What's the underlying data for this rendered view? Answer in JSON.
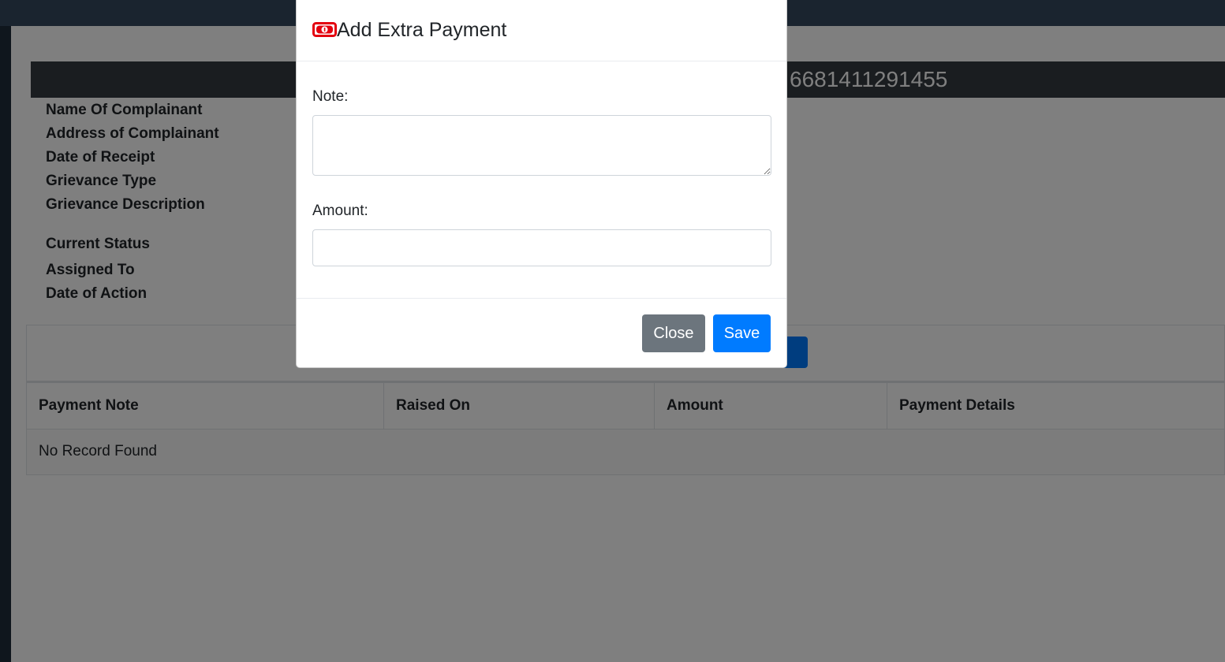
{
  "page": {
    "case_number": "6681411291455",
    "details": {
      "name_of_complainant": "Name Of Complainant",
      "address_of_complainant": "Address of Complainant",
      "date_of_receipt": "Date of Receipt",
      "grievance_type": "Grievance Type",
      "grievance_description": "Grievance Description",
      "current_status": "Current Status",
      "assigned_to": "Assigned To",
      "date_of_action": "Date of Action"
    },
    "table": {
      "headers": [
        "Payment Note",
        "Raised On",
        "Amount",
        "Payment Details"
      ],
      "empty_message": "No Record Found"
    }
  },
  "modal": {
    "icon": "money-bill-icon",
    "icon_color": "#e3000f",
    "title": "Add Extra Payment",
    "note_label": "Note:",
    "note_value": "",
    "amount_label": "Amount:",
    "amount_value": "",
    "close_label": "Close",
    "save_label": "Save"
  },
  "colors": {
    "topbar": "#34495e",
    "header_bar": "#343a40",
    "primary": "#007bff",
    "secondary": "#6c757d"
  }
}
